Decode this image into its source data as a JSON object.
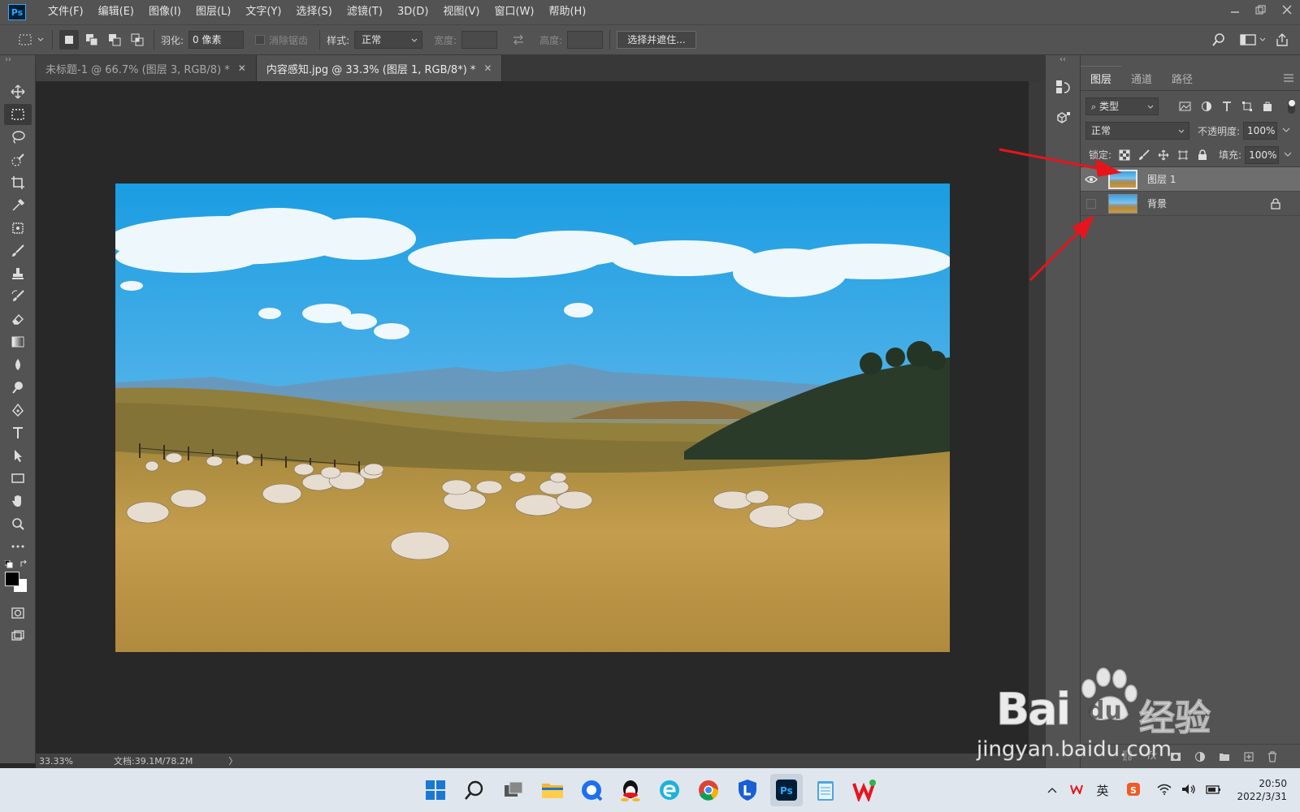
{
  "menubar": {
    "logo": "Ps",
    "items": [
      "文件(F)",
      "编辑(E)",
      "图像(I)",
      "图层(L)",
      "文字(Y)",
      "选择(S)",
      "滤镜(T)",
      "3D(D)",
      "视图(V)",
      "窗口(W)",
      "帮助(H)"
    ]
  },
  "options": {
    "feather_label": "羽化:",
    "feather_value": "0 像素",
    "antialias_label": "消除锯齿",
    "style_label": "样式:",
    "style_value": "正常",
    "width_label": "宽度:",
    "height_label": "高度:",
    "select_mask_button": "选择并遮住..."
  },
  "tabs": [
    {
      "label": "未标题-1 @ 66.7% (图层 3, RGB/8) *"
    },
    {
      "label": "内容感知.jpg @ 33.3% (图层 1, RGB/8*) *"
    }
  ],
  "status": {
    "zoom": "33.33%",
    "doc": "文档:39.1M/78.2M",
    "arrow": "〉"
  },
  "layers_panel": {
    "tabs": [
      "图层",
      "通道",
      "路径"
    ],
    "filter_kind": "类型",
    "blend_mode": "正常",
    "opacity_label": "不透明度:",
    "opacity_value": "100%",
    "lock_label": "锁定:",
    "fill_label": "填充:",
    "fill_value": "100%",
    "layers": [
      {
        "name": "图层 1",
        "visible": true,
        "selected": true,
        "locked": false
      },
      {
        "name": "背景",
        "visible": false,
        "selected": false,
        "locked": true
      }
    ]
  },
  "taskbar": {
    "ime": "英",
    "time": "20:50",
    "date": "2022/3/31"
  },
  "watermark": {
    "brand": "Bai",
    "brand2": "du",
    "suffix": "经验",
    "url": "jingyan.baidu.com"
  },
  "colors": {
    "annotation_arrow": "#e8141c",
    "ps_blue": "#31a8ff"
  }
}
